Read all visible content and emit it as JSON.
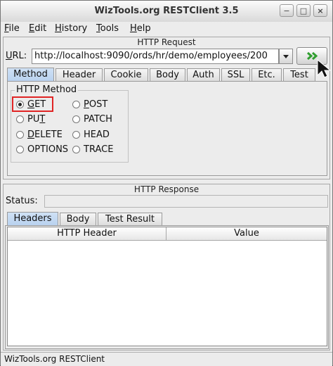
{
  "window": {
    "title": "WizTools.org RESTClient 3.5",
    "controls": {
      "minimize": "−",
      "maximize": "□",
      "close": "×"
    }
  },
  "menu": {
    "items": [
      {
        "first": "F",
        "rest": "ile"
      },
      {
        "first": "E",
        "rest": "dit"
      },
      {
        "first": "H",
        "rest": "istory"
      },
      {
        "first": "T",
        "rest": "ools"
      },
      {
        "first": "H",
        "rest": "elp"
      }
    ]
  },
  "request": {
    "panel_title": "HTTP Request",
    "url_label": "URL:",
    "url_value": "http://localhost:9090/ords/hr/demo/employees/200",
    "go_glyph": ">>",
    "tabs": [
      "Method",
      "Header",
      "Cookie",
      "Body",
      "Auth",
      "SSL",
      "Etc.",
      "Test"
    ],
    "active_tab": "Method",
    "method_group_title": "HTTP Method",
    "methods": [
      {
        "pre": "",
        "key": "G",
        "post": "ET",
        "selected": true
      },
      {
        "pre": "",
        "key": "P",
        "post": "OST",
        "selected": false
      },
      {
        "pre": "PU",
        "key": "T",
        "post": "",
        "selected": false
      },
      {
        "pre": "PATCH",
        "key": "",
        "post": "",
        "selected": false
      },
      {
        "pre": "",
        "key": "D",
        "post": "ELETE",
        "selected": false
      },
      {
        "pre": "HEAD",
        "key": "",
        "post": "",
        "selected": false
      },
      {
        "pre": "OPTIONS",
        "key": "",
        "post": "",
        "selected": false
      },
      {
        "pre": "TRACE",
        "key": "",
        "post": "",
        "selected": false
      }
    ]
  },
  "response": {
    "panel_title": "HTTP Response",
    "status_label": "Status:",
    "status_value": "",
    "tabs": [
      "Headers",
      "Body",
      "Test Result"
    ],
    "active_tab": "Headers",
    "columns": [
      "HTTP Header",
      "Value"
    ]
  },
  "statusbar": {
    "text": "WizTools.org RESTClient"
  },
  "colors": {
    "highlight_box": "#e02424",
    "go_arrow": "#2f9e2f",
    "active_tab": "#b8d1ef"
  }
}
